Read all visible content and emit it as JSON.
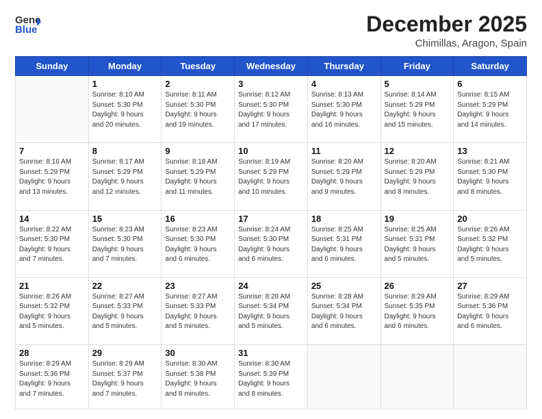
{
  "logo": {
    "general": "General",
    "blue": "Blue"
  },
  "title": "December 2025",
  "location": "Chimillas, Aragon, Spain",
  "days_of_week": [
    "Sunday",
    "Monday",
    "Tuesday",
    "Wednesday",
    "Thursday",
    "Friday",
    "Saturday"
  ],
  "weeks": [
    [
      {
        "day": "",
        "content": ""
      },
      {
        "day": "1",
        "content": "Sunrise: 8:10 AM\nSunset: 5:30 PM\nDaylight: 9 hours\nand 20 minutes."
      },
      {
        "day": "2",
        "content": "Sunrise: 8:11 AM\nSunset: 5:30 PM\nDaylight: 9 hours\nand 19 minutes."
      },
      {
        "day": "3",
        "content": "Sunrise: 8:12 AM\nSunset: 5:30 PM\nDaylight: 9 hours\nand 17 minutes."
      },
      {
        "day": "4",
        "content": "Sunrise: 8:13 AM\nSunset: 5:30 PM\nDaylight: 9 hours\nand 16 minutes."
      },
      {
        "day": "5",
        "content": "Sunrise: 8:14 AM\nSunset: 5:29 PM\nDaylight: 9 hours\nand 15 minutes."
      },
      {
        "day": "6",
        "content": "Sunrise: 8:15 AM\nSunset: 5:29 PM\nDaylight: 9 hours\nand 14 minutes."
      }
    ],
    [
      {
        "day": "7",
        "content": "Sunrise: 8:16 AM\nSunset: 5:29 PM\nDaylight: 9 hours\nand 13 minutes."
      },
      {
        "day": "8",
        "content": "Sunrise: 8:17 AM\nSunset: 5:29 PM\nDaylight: 9 hours\nand 12 minutes."
      },
      {
        "day": "9",
        "content": "Sunrise: 8:18 AM\nSunset: 5:29 PM\nDaylight: 9 hours\nand 11 minutes."
      },
      {
        "day": "10",
        "content": "Sunrise: 8:19 AM\nSunset: 5:29 PM\nDaylight: 9 hours\nand 10 minutes."
      },
      {
        "day": "11",
        "content": "Sunrise: 8:20 AM\nSunset: 5:29 PM\nDaylight: 9 hours\nand 9 minutes."
      },
      {
        "day": "12",
        "content": "Sunrise: 8:20 AM\nSunset: 5:29 PM\nDaylight: 9 hours\nand 8 minutes."
      },
      {
        "day": "13",
        "content": "Sunrise: 8:21 AM\nSunset: 5:30 PM\nDaylight: 9 hours\nand 8 minutes."
      }
    ],
    [
      {
        "day": "14",
        "content": "Sunrise: 8:22 AM\nSunset: 5:30 PM\nDaylight: 9 hours\nand 7 minutes."
      },
      {
        "day": "15",
        "content": "Sunrise: 8:23 AM\nSunset: 5:30 PM\nDaylight: 9 hours\nand 7 minutes."
      },
      {
        "day": "16",
        "content": "Sunrise: 8:23 AM\nSunset: 5:30 PM\nDaylight: 9 hours\nand 6 minutes."
      },
      {
        "day": "17",
        "content": "Sunrise: 8:24 AM\nSunset: 5:30 PM\nDaylight: 9 hours\nand 6 minutes."
      },
      {
        "day": "18",
        "content": "Sunrise: 8:25 AM\nSunset: 5:31 PM\nDaylight: 9 hours\nand 6 minutes."
      },
      {
        "day": "19",
        "content": "Sunrise: 8:25 AM\nSunset: 5:31 PM\nDaylight: 9 hours\nand 5 minutes."
      },
      {
        "day": "20",
        "content": "Sunrise: 8:26 AM\nSunset: 5:32 PM\nDaylight: 9 hours\nand 5 minutes."
      }
    ],
    [
      {
        "day": "21",
        "content": "Sunrise: 8:26 AM\nSunset: 5:32 PM\nDaylight: 9 hours\nand 5 minutes."
      },
      {
        "day": "22",
        "content": "Sunrise: 8:27 AM\nSunset: 5:33 PM\nDaylight: 9 hours\nand 5 minutes."
      },
      {
        "day": "23",
        "content": "Sunrise: 8:27 AM\nSunset: 5:33 PM\nDaylight: 9 hours\nand 5 minutes."
      },
      {
        "day": "24",
        "content": "Sunrise: 8:28 AM\nSunset: 5:34 PM\nDaylight: 9 hours\nand 5 minutes."
      },
      {
        "day": "25",
        "content": "Sunrise: 8:28 AM\nSunset: 5:34 PM\nDaylight: 9 hours\nand 6 minutes."
      },
      {
        "day": "26",
        "content": "Sunrise: 8:29 AM\nSunset: 5:35 PM\nDaylight: 9 hours\nand 6 minutes."
      },
      {
        "day": "27",
        "content": "Sunrise: 8:29 AM\nSunset: 5:36 PM\nDaylight: 9 hours\nand 6 minutes."
      }
    ],
    [
      {
        "day": "28",
        "content": "Sunrise: 8:29 AM\nSunset: 5:36 PM\nDaylight: 9 hours\nand 7 minutes."
      },
      {
        "day": "29",
        "content": "Sunrise: 8:29 AM\nSunset: 5:37 PM\nDaylight: 9 hours\nand 7 minutes."
      },
      {
        "day": "30",
        "content": "Sunrise: 8:30 AM\nSunset: 5:38 PM\nDaylight: 9 hours\nand 8 minutes."
      },
      {
        "day": "31",
        "content": "Sunrise: 8:30 AM\nSunset: 5:39 PM\nDaylight: 9 hours\nand 8 minutes."
      },
      {
        "day": "",
        "content": ""
      },
      {
        "day": "",
        "content": ""
      },
      {
        "day": "",
        "content": ""
      }
    ]
  ]
}
